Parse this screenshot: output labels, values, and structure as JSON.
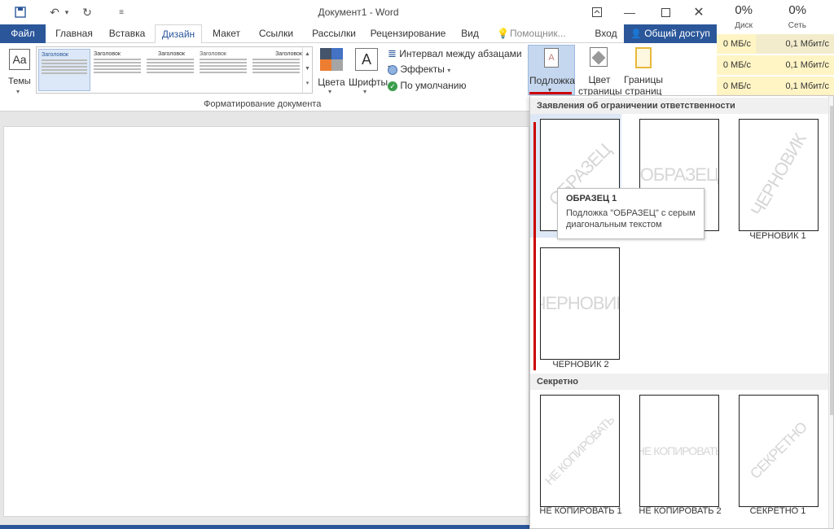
{
  "window": {
    "title": "Документ1 - Word"
  },
  "tabs": {
    "file": "Файл",
    "home": "Главная",
    "insert": "Вставка",
    "design": "Дизайн",
    "layout": "Макет",
    "references": "Ссылки",
    "mailings": "Рассылки",
    "review": "Рецензирование",
    "view": "Вид",
    "tellme": "Помощник...",
    "signin": "Вход",
    "share": "Общий доступ"
  },
  "ribbon": {
    "themes": "Темы",
    "colors": "Цвета",
    "fonts": "Шрифты",
    "paragraph_spacing": "Интервал между абзацами",
    "effects": "Эффекты",
    "default": "По умолчанию",
    "group_caption": "Форматирование документа",
    "watermark": "Подложка",
    "page_color_line1": "Цвет",
    "page_color_line2": "страницы",
    "page_borders_line1": "Границы",
    "page_borders_line2": "страниц",
    "gallery_heading": "Заголовок"
  },
  "monitor": {
    "disk_pct": "0%",
    "disk_label": "Диск",
    "net_pct": "0%",
    "net_label": "Сеть",
    "rows": [
      {
        "disk": "0 МБ/с",
        "net": "0,1 Мбит/с"
      },
      {
        "disk": "0 МБ/с",
        "net": "0,1 Мбит/с"
      },
      {
        "disk": "0 МБ/с",
        "net": "0,1 Мбит/с"
      }
    ]
  },
  "panel": {
    "section1": "Заявления об ограничении ответственности",
    "section2": "Секретно",
    "items": [
      {
        "label": "",
        "watermark": "ОБРАЗЕЦ"
      },
      {
        "label": "",
        "watermark": "ОБРАЗЕЦ"
      },
      {
        "label": "ЧЕРНОВИК 1",
        "watermark": "ЧЕРНОВИК"
      },
      {
        "label": "ЧЕРНОВИК 2",
        "watermark": "ЧЕРНОВИК"
      },
      {
        "label": "НЕ КОПИРОВАТЬ 1",
        "watermark": "НЕ КОПИРОВАТЬ"
      },
      {
        "label": "НЕ КОПИРОВАТЬ 2",
        "watermark": "НЕ КОПИРОВАТЬ"
      },
      {
        "label": "СЕКРЕТНО 1",
        "watermark": "СЕКРЕТНО"
      }
    ]
  },
  "tooltip": {
    "title": "ОБРАЗЕЦ 1",
    "description": "Подложка \"ОБРАЗЕЦ\" с серым диагональным текстом"
  },
  "colors": {
    "accent": "#2b579a",
    "highlight": "#c00000"
  }
}
